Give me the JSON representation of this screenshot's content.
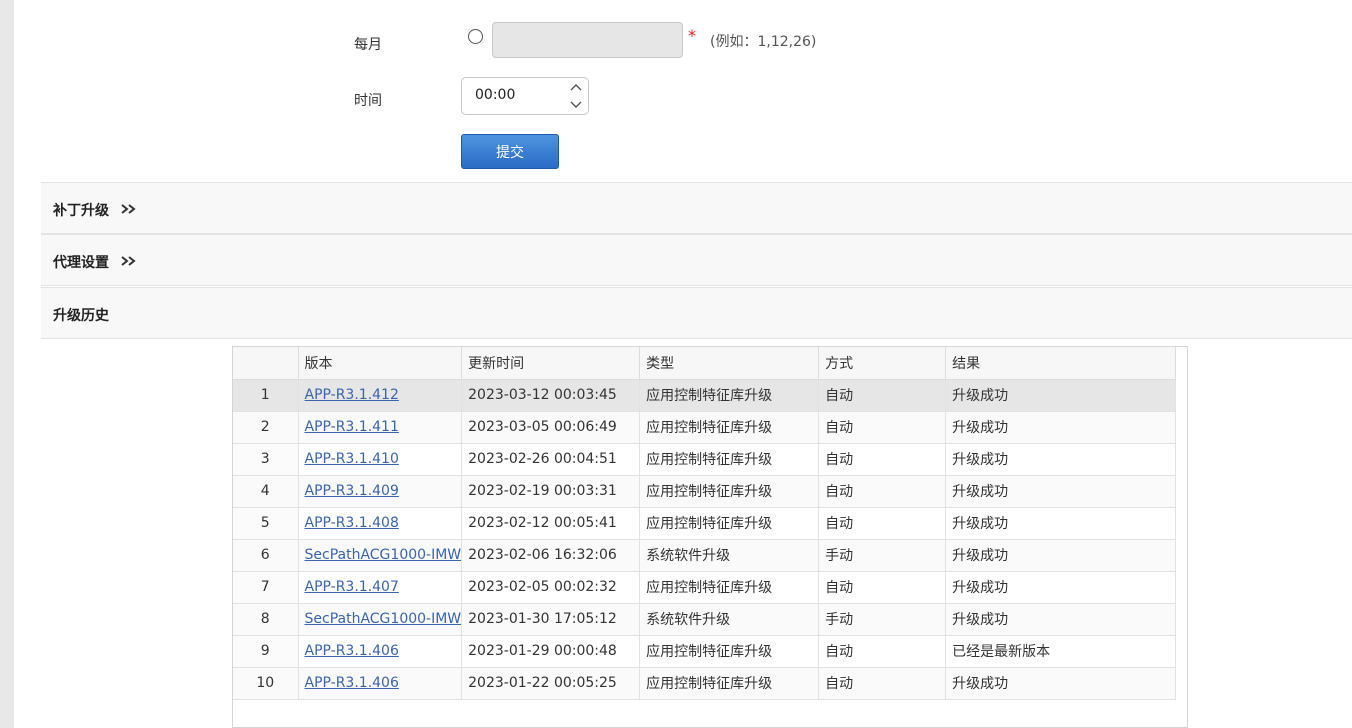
{
  "form": {
    "monthly_label": "每月",
    "monthly_placeholder": "",
    "required_mark": "*",
    "monthly_hint": "(例如：1,12,26)",
    "time_label": "时间",
    "time_value": "00:00",
    "submit_label": "提交"
  },
  "sections": {
    "patch_upgrade": "补丁升级",
    "proxy_settings": "代理设置",
    "upgrade_history": "升级历史"
  },
  "history_table": {
    "columns": [
      "",
      "版本",
      "更新时间",
      "类型",
      "方式",
      "结果"
    ],
    "rows": [
      {
        "index": "1",
        "version": "APP-R3.1.412",
        "time": "2023-03-12 00:03:45",
        "type": "应用控制特征库升级",
        "mode": "自动",
        "result": "升级成功"
      },
      {
        "index": "2",
        "version": "APP-R3.1.411",
        "time": "2023-03-05 00:06:49",
        "type": "应用控制特征库升级",
        "mode": "自动",
        "result": "升级成功"
      },
      {
        "index": "3",
        "version": "APP-R3.1.410",
        "time": "2023-02-26 00:04:51",
        "type": "应用控制特征库升级",
        "mode": "自动",
        "result": "升级成功"
      },
      {
        "index": "4",
        "version": "APP-R3.1.409",
        "time": "2023-02-19 00:03:31",
        "type": "应用控制特征库升级",
        "mode": "自动",
        "result": "升级成功"
      },
      {
        "index": "5",
        "version": "APP-R3.1.408",
        "time": "2023-02-12 00:05:41",
        "type": "应用控制特征库升级",
        "mode": "自动",
        "result": "升级成功"
      },
      {
        "index": "6",
        "version": "SecPathACG1000-IMW",
        "time": "2023-02-06 16:32:06",
        "type": "系统软件升级",
        "mode": "手动",
        "result": "升级成功"
      },
      {
        "index": "7",
        "version": "APP-R3.1.407",
        "time": "2023-02-05 00:02:32",
        "type": "应用控制特征库升级",
        "mode": "自动",
        "result": "升级成功"
      },
      {
        "index": "8",
        "version": "SecPathACG1000-IMW",
        "time": "2023-01-30 17:05:12",
        "type": "系统软件升级",
        "mode": "手动",
        "result": "升级成功"
      },
      {
        "index": "9",
        "version": "APP-R3.1.406",
        "time": "2023-01-29 00:00:48",
        "type": "应用控制特征库升级",
        "mode": "自动",
        "result": "已经是最新版本"
      },
      {
        "index": "10",
        "version": "APP-R3.1.406",
        "time": "2023-01-22 00:05:25",
        "type": "应用控制特征库升级",
        "mode": "自动",
        "result": "升级成功"
      }
    ]
  }
}
